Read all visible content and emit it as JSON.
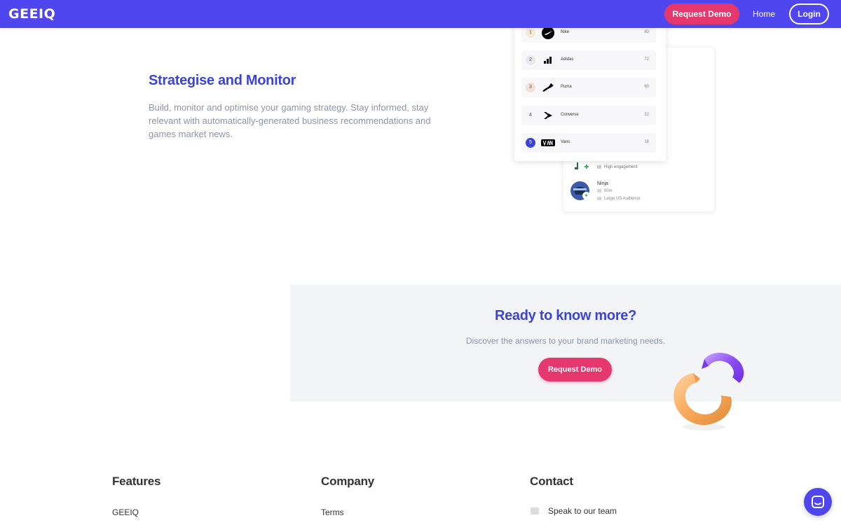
{
  "nav": {
    "logo": "GEEIQ",
    "request_demo": "Request Demo",
    "home": "Home",
    "login": "Login"
  },
  "feature": {
    "title": "Strategise and Monitor",
    "description": "Build, monitor and optimise your gaming strategy. Stay informed, stay relevant with automatically-generated business recommendations and games market news."
  },
  "brands": [
    {
      "rank": "1",
      "name": "Nike",
      "score": "80",
      "rank_color": "#f5ead6",
      "logo": "nike-logo"
    },
    {
      "rank": "2",
      "name": "Adidas",
      "score": "72",
      "rank_color": "#e6e7ef",
      "logo": "adidas-logo"
    },
    {
      "rank": "3",
      "name": "Puma",
      "score": "60",
      "rank_color": "#f1e0d8",
      "logo": "puma-logo"
    },
    {
      "rank": "4",
      "name": "Converse",
      "score": "32",
      "rank_color": "#f7f7f9",
      "logo": "converse-logo"
    },
    {
      "rank": "5",
      "name": "Vans",
      "score": "18",
      "rank_color": "#3c44d8",
      "logo": "vans-logo"
    }
  ],
  "influencers": {
    "partial_engagement": "High engagement",
    "ninja": {
      "name": "Ninja",
      "followers": "60m",
      "audience": "Large US Audience"
    }
  },
  "cta": {
    "title": "Ready to know more?",
    "subtitle": "Discover the answers to your brand marketing needs.",
    "button": "Request Demo"
  },
  "footer": {
    "features": {
      "title": "Features",
      "first_link": "GEEIQ"
    },
    "company": {
      "title": "Company",
      "first_link": "Terms"
    },
    "contact": {
      "title": "Contact",
      "first_link": "Speak to our team"
    }
  },
  "colors": {
    "brand": "#5046f0",
    "accent": "#e5386f",
    "heading": "#3c44d8",
    "muted": "#8d94a8"
  }
}
